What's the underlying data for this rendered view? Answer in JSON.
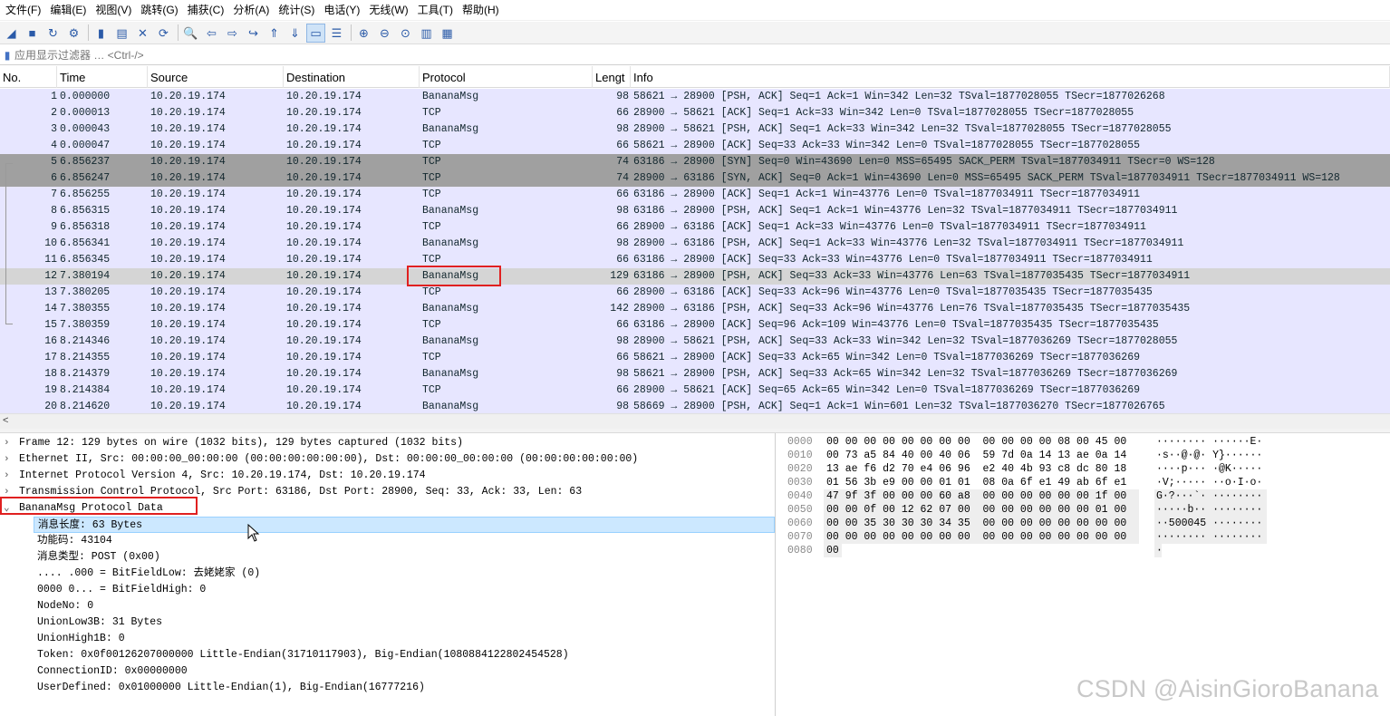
{
  "menu": [
    "文件(F)",
    "编辑(E)",
    "视图(V)",
    "跳转(G)",
    "捕获(C)",
    "分析(A)",
    "统计(S)",
    "电话(Y)",
    "无线(W)",
    "工具(T)",
    "帮助(H)"
  ],
  "toolbar_icons": [
    "shark-fin-start-icon",
    "stop-icon",
    "restart-icon",
    "capture-options-icon",
    "open-file-icon",
    "save-file-icon",
    "close-file-icon",
    "reload-icon",
    "find-packet-icon",
    "go-back-icon",
    "go-forward-icon",
    "go-to-packet-icon",
    "go-first-icon",
    "go-last-icon",
    "auto-scroll-icon",
    "colorize-icon",
    "zoom-in-icon",
    "zoom-out-icon",
    "normal-size-icon",
    "resize-columns-icon",
    "layout-icon"
  ],
  "filter": {
    "placeholder": "应用显示过滤器 … <Ctrl-/>"
  },
  "columns": [
    "No.",
    "Time",
    "Source",
    "Destination",
    "Protocol",
    "Lengt",
    "Info"
  ],
  "packets": [
    {
      "no": "1",
      "time": "0.000000",
      "src": "10.20.19.174",
      "dst": "10.20.19.174",
      "proto": "BananaMsg",
      "len": "98",
      "info": "58621 → 28900 [PSH, ACK] Seq=1 Ack=1 Win=342 Len=32 TSval=1877028055 TSecr=1877026268",
      "style": "normal"
    },
    {
      "no": "2",
      "time": "0.000013",
      "src": "10.20.19.174",
      "dst": "10.20.19.174",
      "proto": "TCP",
      "len": "66",
      "info": "28900 → 58621 [ACK] Seq=1 Ack=33 Win=342 Len=0 TSval=1877028055 TSecr=1877028055",
      "style": "normal"
    },
    {
      "no": "3",
      "time": "0.000043",
      "src": "10.20.19.174",
      "dst": "10.20.19.174",
      "proto": "BananaMsg",
      "len": "98",
      "info": "28900 → 58621 [PSH, ACK] Seq=1 Ack=33 Win=342 Len=32 TSval=1877028055 TSecr=1877028055",
      "style": "normal"
    },
    {
      "no": "4",
      "time": "0.000047",
      "src": "10.20.19.174",
      "dst": "10.20.19.174",
      "proto": "TCP",
      "len": "66",
      "info": "58621 → 28900 [ACK] Seq=33 Ack=33 Win=342 Len=0 TSval=1877028055 TSecr=1877028055",
      "style": "normal"
    },
    {
      "no": "5",
      "time": "6.856237",
      "src": "10.20.19.174",
      "dst": "10.20.19.174",
      "proto": "TCP",
      "len": "74",
      "info": "63186 → 28900 [SYN] Seq=0 Win=43690 Len=0 MSS=65495 SACK_PERM TSval=1877034911 TSecr=0 WS=128",
      "style": "syn"
    },
    {
      "no": "6",
      "time": "6.856247",
      "src": "10.20.19.174",
      "dst": "10.20.19.174",
      "proto": "TCP",
      "len": "74",
      "info": "28900 → 63186 [SYN, ACK] Seq=0 Ack=1 Win=43690 Len=0 MSS=65495 SACK_PERM TSval=1877034911 TSecr=1877034911 WS=128",
      "style": "syn"
    },
    {
      "no": "7",
      "time": "6.856255",
      "src": "10.20.19.174",
      "dst": "10.20.19.174",
      "proto": "TCP",
      "len": "66",
      "info": "63186 → 28900 [ACK] Seq=1 Ack=1 Win=43776 Len=0 TSval=1877034911 TSecr=1877034911",
      "style": "normal"
    },
    {
      "no": "8",
      "time": "6.856315",
      "src": "10.20.19.174",
      "dst": "10.20.19.174",
      "proto": "BananaMsg",
      "len": "98",
      "info": "63186 → 28900 [PSH, ACK] Seq=1 Ack=1 Win=43776 Len=32 TSval=1877034911 TSecr=1877034911",
      "style": "normal"
    },
    {
      "no": "9",
      "time": "6.856318",
      "src": "10.20.19.174",
      "dst": "10.20.19.174",
      "proto": "TCP",
      "len": "66",
      "info": "28900 → 63186 [ACK] Seq=1 Ack=33 Win=43776 Len=0 TSval=1877034911 TSecr=1877034911",
      "style": "normal"
    },
    {
      "no": "10",
      "time": "6.856341",
      "src": "10.20.19.174",
      "dst": "10.20.19.174",
      "proto": "BananaMsg",
      "len": "98",
      "info": "28900 → 63186 [PSH, ACK] Seq=1 Ack=33 Win=43776 Len=32 TSval=1877034911 TSecr=1877034911",
      "style": "normal"
    },
    {
      "no": "11",
      "time": "6.856345",
      "src": "10.20.19.174",
      "dst": "10.20.19.174",
      "proto": "TCP",
      "len": "66",
      "info": "63186 → 28900 [ACK] Seq=33 Ack=33 Win=43776 Len=0 TSval=1877034911 TSecr=1877034911",
      "style": "normal"
    },
    {
      "no": "12",
      "time": "7.380194",
      "src": "10.20.19.174",
      "dst": "10.20.19.174",
      "proto": "BananaMsg",
      "len": "129",
      "info": "63186 → 28900 [PSH, ACK] Seq=33 Ack=33 Win=43776 Len=63 TSval=1877035435 TSecr=1877034911",
      "style": "selected"
    },
    {
      "no": "13",
      "time": "7.380205",
      "src": "10.20.19.174",
      "dst": "10.20.19.174",
      "proto": "TCP",
      "len": "66",
      "info": "28900 → 63186 [ACK] Seq=33 Ack=96 Win=43776 Len=0 TSval=1877035435 TSecr=1877035435",
      "style": "normal"
    },
    {
      "no": "14",
      "time": "7.380355",
      "src": "10.20.19.174",
      "dst": "10.20.19.174",
      "proto": "BananaMsg",
      "len": "142",
      "info": "28900 → 63186 [PSH, ACK] Seq=33 Ack=96 Win=43776 Len=76 TSval=1877035435 TSecr=1877035435",
      "style": "normal"
    },
    {
      "no": "15",
      "time": "7.380359",
      "src": "10.20.19.174",
      "dst": "10.20.19.174",
      "proto": "TCP",
      "len": "66",
      "info": "63186 → 28900 [ACK] Seq=96 Ack=109 Win=43776 Len=0 TSval=1877035435 TSecr=1877035435",
      "style": "normal"
    },
    {
      "no": "16",
      "time": "8.214346",
      "src": "10.20.19.174",
      "dst": "10.20.19.174",
      "proto": "BananaMsg",
      "len": "98",
      "info": "28900 → 58621 [PSH, ACK] Seq=33 Ack=33 Win=342 Len=32 TSval=1877036269 TSecr=1877028055",
      "style": "normal"
    },
    {
      "no": "17",
      "time": "8.214355",
      "src": "10.20.19.174",
      "dst": "10.20.19.174",
      "proto": "TCP",
      "len": "66",
      "info": "58621 → 28900 [ACK] Seq=33 Ack=65 Win=342 Len=0 TSval=1877036269 TSecr=1877036269",
      "style": "normal"
    },
    {
      "no": "18",
      "time": "8.214379",
      "src": "10.20.19.174",
      "dst": "10.20.19.174",
      "proto": "BananaMsg",
      "len": "98",
      "info": "58621 → 28900 [PSH, ACK] Seq=33 Ack=65 Win=342 Len=32 TSval=1877036269 TSecr=1877036269",
      "style": "normal"
    },
    {
      "no": "19",
      "time": "8.214384",
      "src": "10.20.19.174",
      "dst": "10.20.19.174",
      "proto": "TCP",
      "len": "66",
      "info": "28900 → 58621 [ACK] Seq=65 Ack=65 Win=342 Len=0 TSval=1877036269 TSecr=1877036269",
      "style": "normal"
    },
    {
      "no": "20",
      "time": "8.214620",
      "src": "10.20.19.174",
      "dst": "10.20.19.174",
      "proto": "BananaMsg",
      "len": "98",
      "info": "58669 → 28900 [PSH, ACK] Seq=1 Ack=1 Win=601 Len=32 TSval=1877036270 TSecr=1877026765",
      "style": "normal"
    }
  ],
  "details": [
    {
      "text": "Frame 12: 129 bytes on wire (1032 bits), 129 bytes captured (1032 bits)",
      "arrow": ">",
      "child": false,
      "sel": false
    },
    {
      "text": "Ethernet II, Src: 00:00:00_00:00:00 (00:00:00:00:00:00), Dst: 00:00:00_00:00:00 (00:00:00:00:00:00)",
      "arrow": ">",
      "child": false,
      "sel": false
    },
    {
      "text": "Internet Protocol Version 4, Src: 10.20.19.174, Dst: 10.20.19.174",
      "arrow": ">",
      "child": false,
      "sel": false
    },
    {
      "text": "Transmission Control Protocol, Src Port: 63186, Dst Port: 28900, Seq: 33, Ack: 33, Len: 63",
      "arrow": ">",
      "child": false,
      "sel": false
    },
    {
      "text": "BananaMsg Protocol Data",
      "arrow": "v",
      "child": false,
      "sel": false
    },
    {
      "text": "消息长度: 63 Bytes",
      "arrow": "",
      "child": true,
      "sel": true
    },
    {
      "text": "功能码: 43104",
      "arrow": "",
      "child": true,
      "sel": false
    },
    {
      "text": "消息类型: POST (0x00)",
      "arrow": "",
      "child": true,
      "sel": false
    },
    {
      "text": ".... .000 = BitFieldLow: 去姥姥家 (0)",
      "arrow": "",
      "child": true,
      "sel": false
    },
    {
      "text": "0000 0... = BitFieldHigh: 0",
      "arrow": "",
      "child": true,
      "sel": false
    },
    {
      "text": "NodeNo: 0",
      "arrow": "",
      "child": true,
      "sel": false
    },
    {
      "text": "UnionLow3B: 31 Bytes",
      "arrow": "",
      "child": true,
      "sel": false
    },
    {
      "text": "UnionHigh1B: 0",
      "arrow": "",
      "child": true,
      "sel": false
    },
    {
      "text": "Token: 0x0f00126207000000 Little-Endian(31710117903), Big-Endian(1080884122802454528)",
      "arrow": "",
      "child": true,
      "sel": false
    },
    {
      "text": "ConnectionID: 0x00000000",
      "arrow": "",
      "child": true,
      "sel": false
    },
    {
      "text": "UserDefined: 0x01000000 Little-Endian(1), Big-Endian(16777216)",
      "arrow": "",
      "child": true,
      "sel": false
    }
  ],
  "hexdump": [
    {
      "off": "0000",
      "hex": "00 00 00 00 00 00 00 00  00 00 00 00 08 00 45 00",
      "ascii": "········ ······E·",
      "hl": false
    },
    {
      "off": "0010",
      "hex": "00 73 a5 84 40 00 40 06  59 7d 0a 14 13 ae 0a 14",
      "ascii": "·s··@·@· Y}······",
      "hl": false
    },
    {
      "off": "0020",
      "hex": "13 ae f6 d2 70 e4 06 96  e2 40 4b 93 c8 dc 80 18",
      "ascii": "····p··· ·@K·····",
      "hl": false
    },
    {
      "off": "0030",
      "hex": "01 56 3b e9 00 00 01 01  08 0a 6f e1 49 ab 6f e1",
      "ascii": "·V;····· ··o·I·o·",
      "hl": false
    },
    {
      "off": "0040",
      "hex": "47 9f 3f 00 00 00 60 a8  00 00 00 00 00 00 1f 00",
      "ascii": "G·?···`· ········",
      "hl": true
    },
    {
      "off": "0050",
      "hex": "00 00 0f 00 12 62 07 00  00 00 00 00 00 00 01 00",
      "ascii": "·····b·· ········",
      "hl": true
    },
    {
      "off": "0060",
      "hex": "00 00 35 30 30 30 34 35  00 00 00 00 00 00 00 00",
      "ascii": "··500045 ········",
      "hl": true
    },
    {
      "off": "0070",
      "hex": "00 00 00 00 00 00 00 00  00 00 00 00 00 00 00 00",
      "ascii": "········ ········",
      "hl": true
    },
    {
      "off": "0080",
      "hex": "00",
      "ascii": "·",
      "hl": true
    }
  ],
  "hscroll": {
    "left_arrow": "<"
  },
  "watermark": "CSDN @AisinGioroBanana",
  "colors": {
    "row_normal": "#e7e6ff",
    "row_syn": "#a0a0a0",
    "row_selected": "#d5d5d5",
    "highlight": "#e02020",
    "tree_selected": "#cce8ff"
  }
}
